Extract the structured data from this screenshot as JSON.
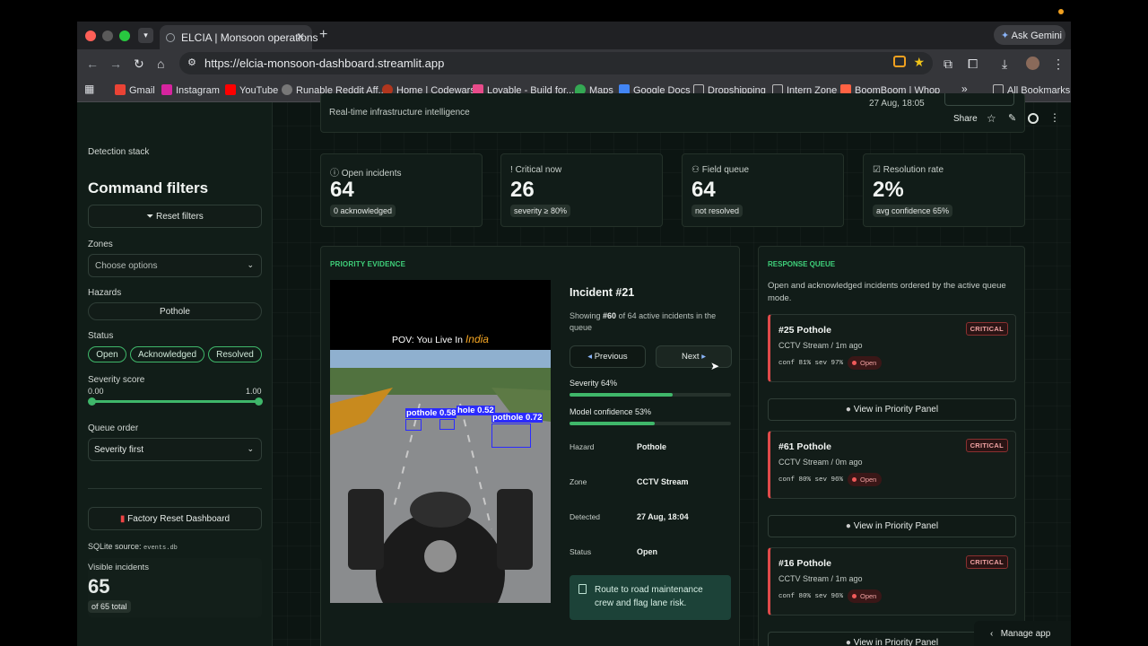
{
  "browser": {
    "tab_title": "ELCIA | Monsoon operations",
    "url": "https://elcia-monsoon-dashboard.streamlit.app",
    "ask_gemini": "Ask Gemini",
    "bookmarks": [
      "Gmail",
      "Instagram",
      "YouTube",
      "Runable Reddit Aff...",
      "Home | Codewars",
      "Lovable - Build for...",
      "Maps",
      "Google Docs",
      "Dropshipping",
      "Intern Zone",
      "BoomBoom | Whop"
    ],
    "all_bookmarks": "All Bookmarks"
  },
  "header": {
    "subtitle": "Real-time infrastructure intelligence",
    "timestamp": "27 Aug, 18:05",
    "share": "Share"
  },
  "sidebar": {
    "stack_label": "Detection stack",
    "title": "Command filters",
    "reset_label": "Reset filters",
    "zones_label": "Zones",
    "zones_placeholder": "Choose options",
    "hazards_label": "Hazards",
    "hazard_value": "Pothole",
    "status_label": "Status",
    "status_options": [
      "Open",
      "Acknowledged",
      "Resolved"
    ],
    "severity_label": "Severity score",
    "severity_min": "0.00",
    "severity_max": "1.00",
    "queue_label": "Queue order",
    "queue_value": "Severity first",
    "factory_reset": "Factory Reset Dashboard",
    "sqlite_label": "SQLite source:",
    "sqlite_file": "events.db",
    "visible_label": "Visible incidents",
    "visible_value": "65",
    "visible_total": "of 65 total"
  },
  "metrics": [
    {
      "label": "Open incidents",
      "value": "64",
      "sub": "0 acknowledged",
      "icon": "info-icon"
    },
    {
      "label": "Critical now",
      "value": "26",
      "sub": "severity ≥ 80%",
      "icon": "exclamation-icon"
    },
    {
      "label": "Field queue",
      "value": "64",
      "sub": "not resolved",
      "icon": "users-icon"
    },
    {
      "label": "Resolution rate",
      "value": "2%",
      "sub": "avg confidence 65%",
      "icon": "check-circle-icon"
    }
  ],
  "evidence": {
    "section_title": "PRIORITY EVIDENCE",
    "video_caption_prefix": "POV: You Live In",
    "video_caption_word": "India",
    "detections": [
      "pothole 0.58",
      "hole 0.52",
      "pothole 0.72"
    ],
    "incident_title": "Incident #21",
    "showing_prefix": "Showing",
    "showing_current": "#60",
    "showing_suffix": "of 64 active incidents in the queue",
    "prev_label": "Previous",
    "next_label": "Next",
    "severity_label": "Severity 64%",
    "severity_fraction": 0.64,
    "confidence_label": "Model confidence 53%",
    "confidence_fraction": 0.53,
    "props": [
      {
        "k": "Hazard",
        "v": "Pothole"
      },
      {
        "k": "Zone",
        "v": "CCTV Stream"
      },
      {
        "k": "Detected",
        "v": "27 Aug, 18:04"
      },
      {
        "k": "Status",
        "v": "Open"
      }
    ],
    "action": "Route to road maintenance crew and flag lane risk."
  },
  "queue": {
    "section_title": "RESPONSE QUEUE",
    "description": "Open and acknowledged incidents ordered by the active queue mode.",
    "badge": "CRITICAL",
    "view_label": "View in Priority Panel",
    "items": [
      {
        "title": "#25 Pothole",
        "meta": "CCTV Stream / 1m ago",
        "stats": "conf 81% sev 97%",
        "status": "Open"
      },
      {
        "title": "#61 Pothole",
        "meta": "CCTV Stream / 0m ago",
        "stats": "conf 80% sev 96%",
        "status": "Open"
      },
      {
        "title": "#16 Pothole",
        "meta": "CCTV Stream / 1m ago",
        "stats": "conf 80% sev 96%",
        "status": "Open"
      }
    ]
  },
  "manage_app": "Manage app"
}
